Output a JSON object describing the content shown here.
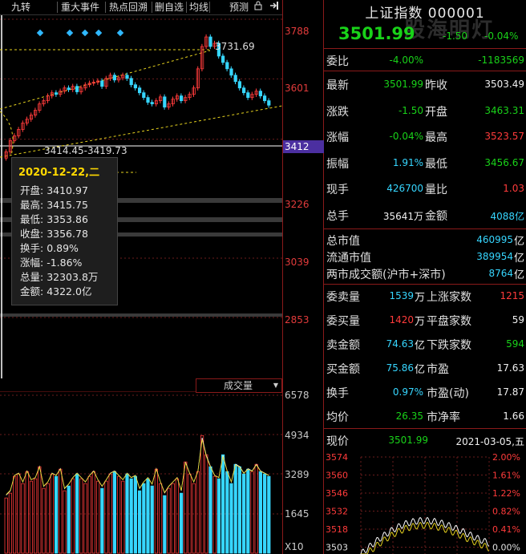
{
  "toolbar": {
    "items": [
      "九转",
      "重大事件",
      "热点回溯",
      "删自选",
      "均线",
      "预测"
    ]
  },
  "chart": {
    "price_axis": [
      "3788",
      "3601",
      "3412",
      "3226",
      "3039",
      "2853"
    ],
    "high_annotation": "3731.69",
    "crosshair_text": "3414.45-3419.73",
    "crosshair_price": "3412",
    "volume_axis": [
      "6578",
      "4934",
      "3289",
      "1645"
    ],
    "volume_tab": "成交量",
    "volume_multiplier": "X10",
    "tooltip": {
      "date": "2020-12-22,二",
      "rows": [
        {
          "label": "开盘",
          "value": "3410.97"
        },
        {
          "label": "最高",
          "value": "3415.75"
        },
        {
          "label": "最低",
          "value": "3353.86"
        },
        {
          "label": "收盘",
          "value": "3356.78"
        },
        {
          "label": "换手",
          "value": "0.89%"
        },
        {
          "label": "涨幅",
          "value": "-1.86%"
        },
        {
          "label": "总量",
          "value": "32303.8万"
        },
        {
          "label": "金额",
          "value": "4322.0亿"
        }
      ]
    }
  },
  "panel": {
    "title": "上证指数 000001",
    "watermark": "股海明灯",
    "price": "3501.99",
    "change": "-1.50",
    "change_pct": "-0.04%",
    "weibi": {
      "label": "委比",
      "pct": "-4.00%",
      "value": "-1183569"
    },
    "grid1": [
      {
        "l1": "最新",
        "v1": "3501.99",
        "c1": "green",
        "l2": "昨收",
        "v2": "3503.49",
        "c2": "white"
      },
      {
        "l1": "涨跌",
        "v1": "-1.50",
        "c1": "green",
        "l2": "开盘",
        "v2": "3463.31",
        "c2": "green"
      },
      {
        "l1": "涨幅",
        "v1": "-0.04%",
        "c1": "green",
        "l2": "最高",
        "v2": "3523.57",
        "c2": "red"
      },
      {
        "l1": "振幅",
        "v1": "1.91%",
        "c1": "cyan",
        "l2": "最低",
        "v2": "3456.67",
        "c2": "green"
      },
      {
        "l1": "现手",
        "v1": "426700",
        "c1": "cyan",
        "l2": "量比",
        "v2": "1.03",
        "c2": "red"
      },
      {
        "l1": "总手",
        "v1": "35641万",
        "c1": "white",
        "l2": "金额",
        "v2": "4088亿",
        "c2": "cyan"
      }
    ],
    "market": [
      {
        "label": "总市值",
        "value": "460995",
        "unit": "亿"
      },
      {
        "label": "流通市值",
        "value": "389954",
        "unit": "亿"
      },
      {
        "label": "两市成交额(沪市+深市)",
        "value": "8764",
        "unit": "亿"
      }
    ],
    "grid2": [
      {
        "l1": "委卖量",
        "v1": "1539",
        "u1": "万",
        "c1": "cyan",
        "l2": "上涨家数",
        "v2": "1215",
        "c2": "red"
      },
      {
        "l1": "委买量",
        "v1": "1420",
        "u1": "万",
        "c1": "red",
        "l2": "平盘家数",
        "v2": "59",
        "c2": "white"
      },
      {
        "l1": "卖金额",
        "v1": "74.63",
        "u1": "亿",
        "c1": "cyan",
        "l2": "下跌家数",
        "v2": "594",
        "c2": "green"
      },
      {
        "l1": "买金额",
        "v1": "75.86",
        "u1": "亿",
        "c1": "cyan",
        "l2": "市盈",
        "v2": "17.63",
        "c2": "white"
      },
      {
        "l1": "换手",
        "v1": "0.97%",
        "u1": "",
        "c1": "cyan",
        "l2": "市盈(动)",
        "v2": "17.87",
        "c2": "white"
      },
      {
        "l1": "均价",
        "v1": "26.35",
        "u1": "",
        "c1": "green",
        "l2": "市净率",
        "v2": "1.66",
        "c2": "white"
      }
    ],
    "mini": {
      "label": "现价",
      "price": "3501.99",
      "date": "2021-03-05,五",
      "left_axis": [
        "3574",
        "3560",
        "3546",
        "3532",
        "3518",
        "3503"
      ],
      "right_axis": [
        "2.00%",
        "1.61%",
        "1.22%",
        "0.82%",
        "0.41%",
        "0.00%"
      ]
    }
  }
}
